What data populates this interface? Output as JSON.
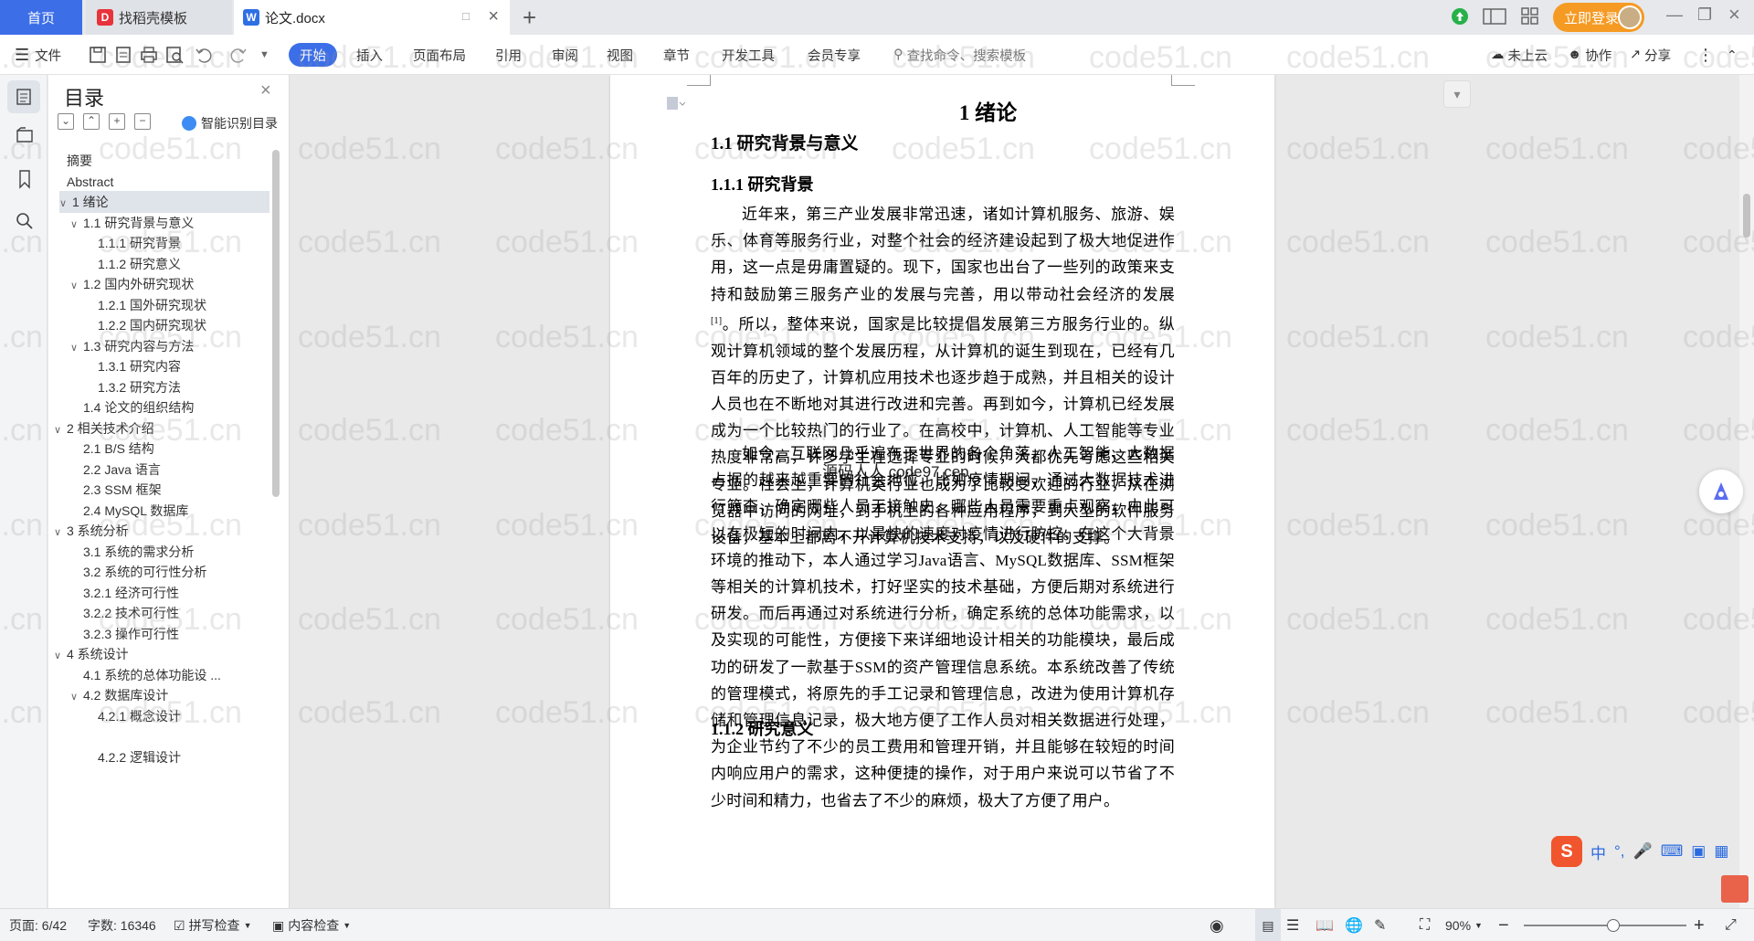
{
  "tabs": {
    "home": "首页",
    "template": "找稻壳模板",
    "doc": "论文.docx",
    "login": "立即登录"
  },
  "ribbon": {
    "file": "文件",
    "items": [
      "开始",
      "插入",
      "页面布局",
      "引用",
      "审阅",
      "视图",
      "章节",
      "开发工具",
      "会员专享"
    ],
    "search_placeholder": "查找命令、搜索模板",
    "cloud": "未上云",
    "collab": "协作",
    "share": "分享"
  },
  "toc": {
    "title": "目录",
    "smart": "智能识别目录",
    "items": [
      {
        "label": "摘要",
        "level": 0,
        "arrow": ""
      },
      {
        "label": "Abstract",
        "level": 0,
        "arrow": ""
      },
      {
        "label": "1  绪论",
        "level": 0,
        "arrow": "v"
      },
      {
        "label": "1.1  研究背景与意义",
        "level": 1,
        "arrow": "v"
      },
      {
        "label": "1.1.1  研究背景",
        "level": 2,
        "arrow": ""
      },
      {
        "label": "1.1.2  研究意义",
        "level": 2,
        "arrow": ""
      },
      {
        "label": "1.2  国内外研究现状",
        "level": 1,
        "arrow": "v"
      },
      {
        "label": "1.2.1  国外研究现状",
        "level": 2,
        "arrow": ""
      },
      {
        "label": "1.2.2  国内研究现状",
        "level": 2,
        "arrow": ""
      },
      {
        "label": "1.3  研究内容与方法",
        "level": 1,
        "arrow": "v"
      },
      {
        "label": "1.3.1  研究内容",
        "level": 2,
        "arrow": ""
      },
      {
        "label": "1.3.2  研究方法",
        "level": 2,
        "arrow": ""
      },
      {
        "label": "1.4  论文的组织结构",
        "level": 1,
        "arrow": ""
      },
      {
        "label": "2  相关技术介绍",
        "level": 0,
        "arrow": "v"
      },
      {
        "label": "2.1 B/S 结构",
        "level": 1,
        "arrow": ""
      },
      {
        "label": "2.2 Java 语言",
        "level": 1,
        "arrow": ""
      },
      {
        "label": "2.3 SSM 框架",
        "level": 1,
        "arrow": ""
      },
      {
        "label": "2.4 MySQL 数据库",
        "level": 1,
        "arrow": ""
      },
      {
        "label": "3  系统分析",
        "level": 0,
        "arrow": "v"
      },
      {
        "label": "3.1  系统的需求分析",
        "level": 1,
        "arrow": ""
      },
      {
        "label": "3.2  系统的可行性分析",
        "level": 1,
        "arrow": ""
      },
      {
        "label": "3.2.1  经济可行性",
        "level": 1,
        "arrow": ""
      },
      {
        "label": "3.2.2  技术可行性",
        "level": 1,
        "arrow": ""
      },
      {
        "label": "3.2.3  操作可行性",
        "level": 1,
        "arrow": ""
      },
      {
        "label": "4  系统设计",
        "level": 0,
        "arrow": "v"
      },
      {
        "label": "4.1  系统的总体功能设 ...",
        "level": 1,
        "arrow": ""
      },
      {
        "label": "4.2  数据库设计",
        "level": 1,
        "arrow": "v"
      },
      {
        "label": "4.2.1  概念设计",
        "level": 2,
        "arrow": ""
      },
      {
        "label": "",
        "level": 2,
        "arrow": ""
      },
      {
        "label": "4.2.2 逻辑设计",
        "level": 2,
        "arrow": ""
      }
    ]
  },
  "document": {
    "h1": "1  绪论",
    "h2": "1.1  研究背景与意义",
    "h3a": "1.1.1  研究背景",
    "p1_part1": "近年来，第三产业发展非常迅速，诸如计算机服务、旅游、娱乐、体育等服务行业，对整个社会的经济建设起到了极大地促进作用，这一点是毋庸置疑的。现下，国家也出台了一些列的政策来支持和鼓励第三服务产业的发展与完善，用以带动社会经济的发展",
    "p1_sup": "[1]",
    "p1_part2": "。所以，整体来说，国家是比较提倡发展第三方服务行业的。纵观计算机领域的整个发展历程，从计算机的诞生到现在，已经有几百年的历史了，计算机应用技术也逐步趋于成熟，并且相关的设计人员也在不断地对其进行改进和完善。再到如今，计算机已经发展成为一个比较热门的行业了。在高校中，计算机、人工智能等专业热度非常高，许多学生在选择专业的时候，大都优先考虑这些相关专业。社会上，计算机类行业也成为了比较受欢迎的行业，从在浏览器中访问的网址，到手机上的各种应用程序，到大型的软件服务设备，基本上都离不开计算机技术支持，以及硬件的支撑。",
    "overlay": "源码人人 code97.cep",
    "p2": "如今，互联网几乎遍布于世界的各个角落，人工智能、大数据占据的越来越重要的社会地位，比如疫情期间，通过大数据技术进行筛查，确定哪些人员无接触史，哪些人员需要重点观察，由此可以在极短的时间内，以最快的速度对疫情进行防控。在这个大背景环境的推动下，本人通过学习Java语言、MySQL数据库、SSM框架等相关的计算机技术，打好坚实的技术基础，方便后期对系统进行研发。而后再通过对系统进行分析，确定系统的总体功能需求，以及实现的可能性，方便接下来详细地设计相关的功能模块，最后成功的研发了一款基于SSM的资产管理信息系统。本系统改善了传统的管理模式，将原先的手工记录和管理信息，改进为使用计算机存储和管理信息记录，极大地方便了工作人员对相关数据进行处理，为企业节约了不少的员工费用和管理开销，并且能够在较短的时间内响应用户的需求，这种便捷的操作，对于用户来说可以节省了不少时间和精力，也省去了不少的麻烦，极大了方便了用户。",
    "h3b": "1.1.2  研究意义"
  },
  "ime": {
    "lang": "中",
    "punct": "°,"
  },
  "watermark": "code51.cn",
  "status": {
    "page": "页面: 6/42",
    "words": "字数: 16346",
    "spell": "拼写检查",
    "content": "内容检查",
    "zoom": "90%",
    "zoom_level": 0.55
  },
  "colors": {
    "accent": "#3c6ee8",
    "login": "#f59a23"
  }
}
